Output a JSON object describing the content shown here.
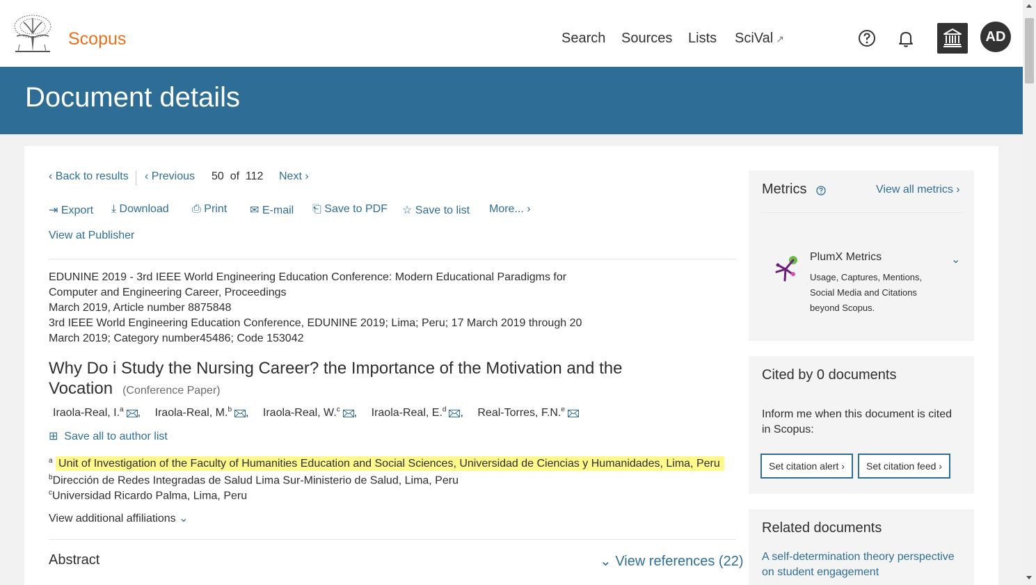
{
  "header": {
    "brand": "Scopus",
    "nav": [
      "Search",
      "Sources",
      "Lists",
      "SciVal"
    ],
    "scival_ext": "↗",
    "avatar": "AD"
  },
  "banner": {
    "title": "Document details"
  },
  "doc_nav": {
    "back": "Back to results",
    "previous": "Previous",
    "position": "50  of  112",
    "next": "Next"
  },
  "actions": {
    "export": "Export",
    "download": "Download",
    "print": "Print",
    "email": "E-mail",
    "save_pdf": "Save to PDF",
    "save_list": "Save to list",
    "more": "More..."
  },
  "view_publisher": "View at Publisher",
  "source_lines": [
    "EDUNINE 2019 - 3rd IEEE World Engineering Education Conference: Modern Educational Paradigms for",
    "Computer and Engineering Career, Proceedings",
    "March 2019, Article number 8875848",
    "3rd IEEE World Engineering Education Conference, EDUNINE 2019; Lima; Peru; 17 March 2019 through 20",
    "March 2019; Category number45486; Code 153042"
  ],
  "title_line1": "Why Do i Study the Nursing Career? the Importance of the Motivation and the",
  "title_line2": "Vocation",
  "doc_type": "(Conference Paper)",
  "authors": [
    {
      "name": "Iraola-Real, I.",
      "sup": "a"
    },
    {
      "name": "Iraola-Real, M.",
      "sup": "b"
    },
    {
      "name": "Iraola-Real, W.",
      "sup": "c"
    },
    {
      "name": "Iraola-Real, E.",
      "sup": "d"
    },
    {
      "name": "Real-Torres, F.N.",
      "sup": "e"
    }
  ],
  "save_authors": "Save all to author list",
  "affiliations": [
    {
      "sup": "a",
      "text": "Unit of Investigation of the Faculty of Humanities Education and Social Sciences, Universidad de Ciencias y Humanidades, Lima, Peru"
    },
    {
      "sup": "b",
      "text": "Dirección de Redes Integradas de Salud Lima Sur-Ministerio de Salud, Lima, Peru"
    },
    {
      "sup": "c",
      "text": "Universidad Ricardo Palma, Lima, Peru"
    }
  ],
  "view_affiliations": "View additional affiliations",
  "abstract_label": "Abstract",
  "view_references": "View references (22)",
  "metrics": {
    "title": "Metrics",
    "view_all": "View all metrics",
    "plumx_title": "PlumX Metrics",
    "plumx_desc": [
      "Usage, Captures, Mentions,",
      "Social Media and Citations",
      "beyond Scopus."
    ]
  },
  "cited": {
    "title": "Cited by 0 documents",
    "desc": [
      "Inform me when this document is cited",
      "in Scopus:"
    ],
    "alert": "Set citation alert",
    "feed": "Set citation feed"
  },
  "related": {
    "title": "Related documents",
    "items": [
      "A self-determination theory perspective",
      "on student engagement"
    ]
  },
  "colors": {
    "brand": "#e9711c",
    "banner": "#2e6e96",
    "link": "#2e6e96",
    "highlight": "#fff88a"
  }
}
